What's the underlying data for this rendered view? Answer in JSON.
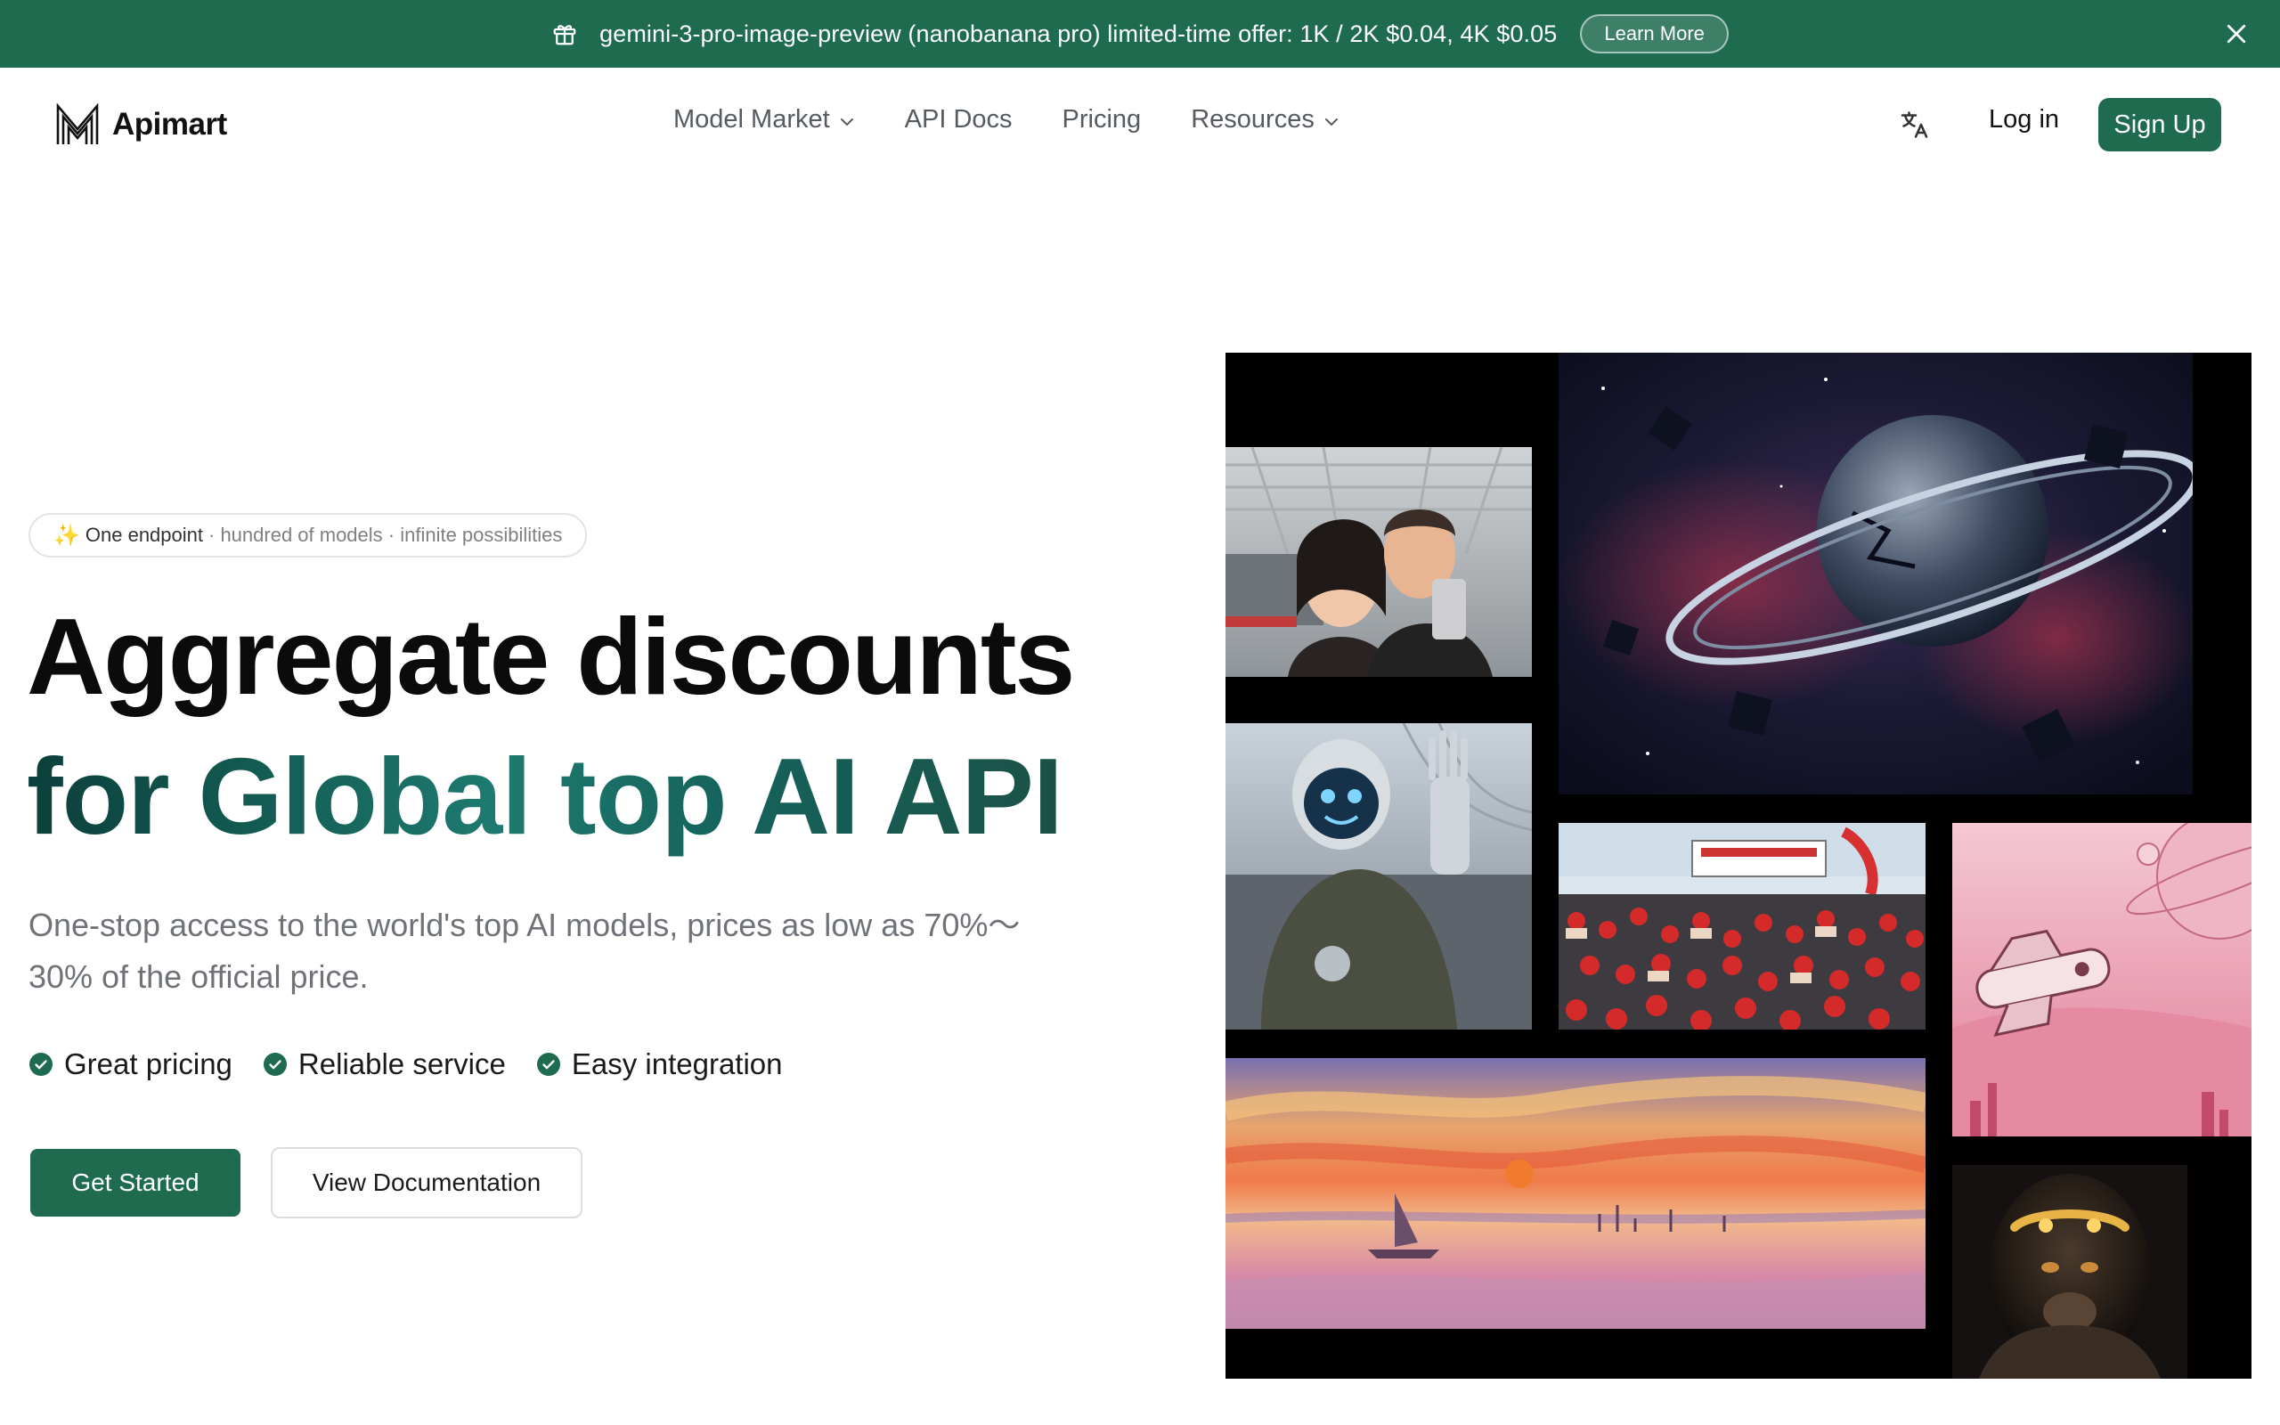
{
  "banner": {
    "text": "gemini-3-pro-image-preview (nanobanana pro) limited-time offer: 1K / 2K $0.04, 4K $0.05",
    "cta": "Learn More",
    "icon": "gift-icon",
    "close_icon": "close-icon",
    "background": "#1e6b4f"
  },
  "nav": {
    "brand": "Apimart",
    "links": [
      {
        "label": "Model Market",
        "has_dropdown": true
      },
      {
        "label": "API Docs",
        "has_dropdown": false
      },
      {
        "label": "Pricing",
        "has_dropdown": false
      },
      {
        "label": "Resources",
        "has_dropdown": true
      }
    ],
    "language_icon": "translate-icon",
    "login": "Log in",
    "signup": "Sign Up"
  },
  "hero": {
    "chip": {
      "emoji": "✨",
      "strong": "One endpoint",
      "rest": "· hundred of models · infinite possibilities"
    },
    "title_line1": "Aggregate discounts",
    "title_line2": "for Global top AI API",
    "subtitle": "One-stop access to the world's top AI models, prices as low as 70%〜30% of the official price.",
    "features": [
      "Great pricing",
      "Reliable service",
      "Easy integration"
    ],
    "primary_cta": "Get Started",
    "secondary_cta": "View Documentation"
  },
  "gallery": {
    "images": [
      "selfie-photo",
      "broken-planet-space-art",
      "humanoid-robot-photo",
      "lobster-market-crowd-photo",
      "pink-planet-spaceship-illustration",
      "watercolor-sunset-harbor-painting",
      "monkey-king-portrait"
    ]
  },
  "colors": {
    "accent": "#1e6b4f",
    "title_gradient_start": "#0c3f3b",
    "title_gradient_end": "#1e7a70"
  }
}
